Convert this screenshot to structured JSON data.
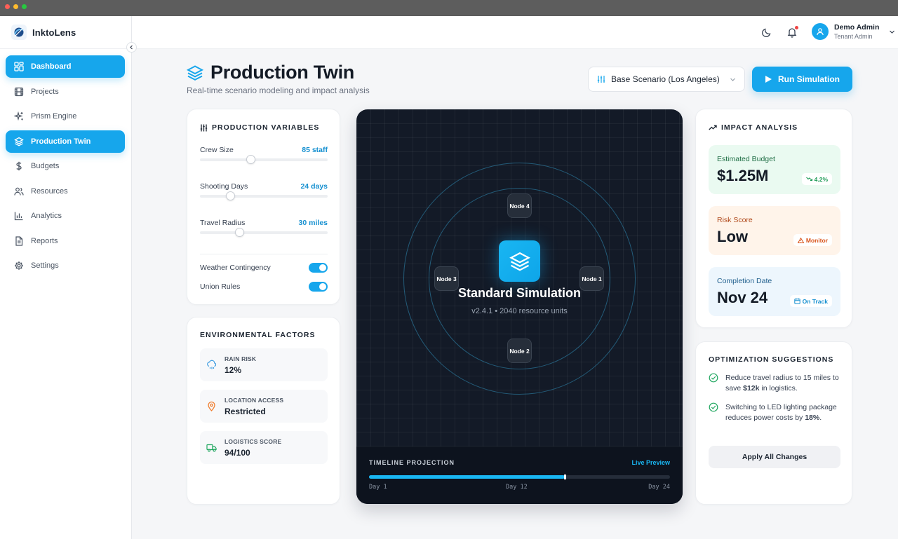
{
  "app": {
    "name": "InktoLens",
    "colors": {
      "accent": "#16a6ec",
      "sidebar_active": "#16a6ec",
      "sim_bg": "#131a27"
    }
  },
  "sidebar": {
    "items": [
      {
        "label": "Dashboard",
        "icon": "dashboard-icon",
        "active": true
      },
      {
        "label": "Projects",
        "icon": "film-icon",
        "active": false
      },
      {
        "label": "Prism Engine",
        "icon": "sparkles-icon",
        "active": false
      },
      {
        "label": "Production Twin",
        "icon": "layers-icon",
        "active": true
      },
      {
        "label": "Budgets",
        "icon": "dollar-icon",
        "active": false
      },
      {
        "label": "Resources",
        "icon": "users-icon",
        "active": false
      },
      {
        "label": "Analytics",
        "icon": "bar-chart-icon",
        "active": false
      },
      {
        "label": "Reports",
        "icon": "file-text-icon",
        "active": false
      },
      {
        "label": "Settings",
        "icon": "gear-icon",
        "active": false
      }
    ]
  },
  "header": {
    "user_name": "Demo Admin",
    "user_role": "Tenant Admin"
  },
  "page": {
    "title": "Production Twin",
    "subtitle": "Real-time scenario modeling and impact analysis",
    "scenario": "Base Scenario (Los Angeles)",
    "run_label": "Run Simulation"
  },
  "variables": {
    "title": "PRODUCTION VARIABLES",
    "items": [
      {
        "label": "Crew Size",
        "value": "85 staff",
        "level": 0.4
      },
      {
        "label": "Shooting Days",
        "value": "24 days",
        "level": 0.24
      },
      {
        "label": "Travel Radius",
        "value": "30 miles",
        "level": 0.31
      }
    ],
    "toggles": [
      {
        "label": "Weather Contingency",
        "on": true
      },
      {
        "label": "Union Rules",
        "on": true
      }
    ]
  },
  "environment": {
    "title": "ENVIRONMENTAL FACTORS",
    "items": [
      {
        "label": "RAIN RISK",
        "value": "12%",
        "icon": "cloud-rain-icon",
        "color": "#3b9be0"
      },
      {
        "label": "LOCATION ACCESS",
        "value": "Restricted",
        "icon": "map-pin-icon",
        "color": "#f07c2c"
      },
      {
        "label": "LOGISTICS SCORE",
        "value": "94/100",
        "icon": "truck-icon",
        "color": "#22a861"
      }
    ]
  },
  "simulation": {
    "title": "Standard Simulation",
    "subtitle": "v2.4.1 • 2040 resource units",
    "nodes": [
      "Node 1",
      "Node 2",
      "Node 3",
      "Node 4"
    ],
    "timeline_label": "TIMELINE PROJECTION",
    "live_label": "Live Preview",
    "progress": 0.65,
    "ticks": [
      "Day 1",
      "Day 12",
      "Day 24"
    ]
  },
  "impact": {
    "title": "IMPACT ANALYSIS",
    "metrics": [
      {
        "label": "Estimated Budget",
        "value": "$1.25M",
        "badge": "4.2%",
        "badge_icon": "trend-down-icon",
        "bg": "#eafaf1",
        "label_color": "#1f6e45",
        "badge_color": "#1c9a55"
      },
      {
        "label": "Risk Score",
        "value": "Low",
        "badge": "Monitor",
        "badge_icon": "warning-icon",
        "bg": "#fff4ea",
        "label_color": "#b0481a",
        "badge_color": "#d9541b"
      },
      {
        "label": "Completion Date",
        "value": "Nov 24",
        "badge": "On Track",
        "badge_icon": "calendar-icon",
        "bg": "#edf6fd",
        "label_color": "#1f5e8c",
        "badge_color": "#1690d0"
      }
    ]
  },
  "optimization": {
    "title": "OPTIMIZATION SUGGESTIONS",
    "s1_pre": "Reduce travel radius to 15 miles to save ",
    "s1_bold": "$12k",
    "s1_post": " in logistics.",
    "s2_pre": "Switching to LED lighting package reduces power costs by ",
    "s2_bold": "18%",
    "s2_post": ".",
    "apply_label": "Apply All Changes"
  }
}
